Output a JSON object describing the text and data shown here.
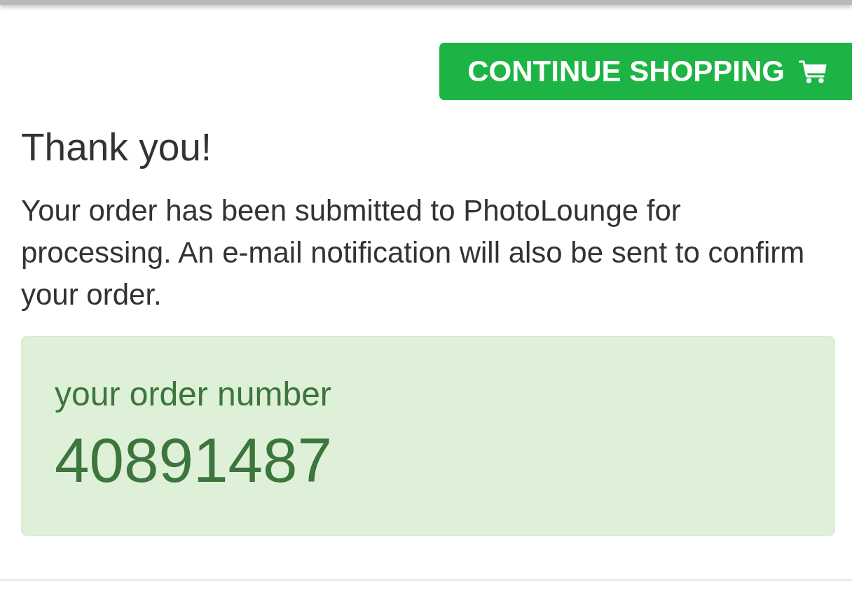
{
  "header_button": {
    "label": "CONTINUE SHOPPING"
  },
  "heading": "Thank you!",
  "message": "Your order has been submitted to PhotoLounge for processing. An e-mail notification will also be sent to confirm your order.",
  "order_panel": {
    "label": "your order number",
    "order_number": "40891487"
  }
}
